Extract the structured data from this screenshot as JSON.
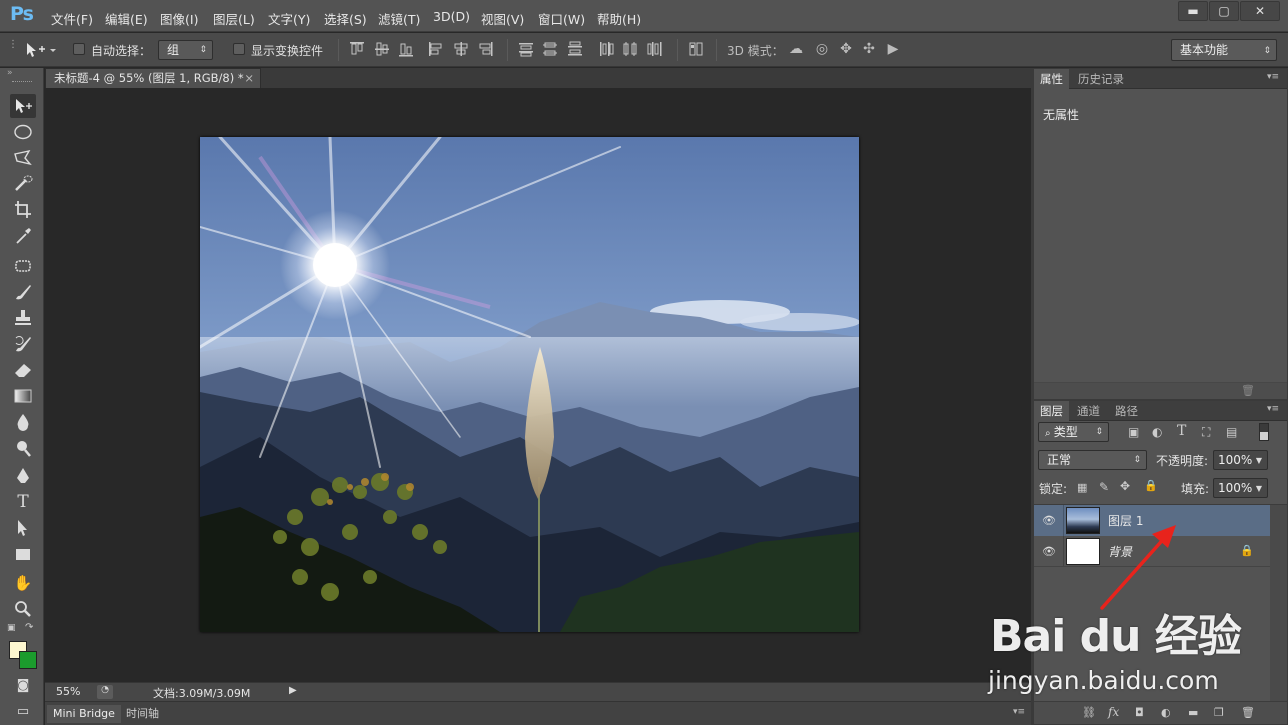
{
  "app": {
    "logo": "Ps"
  },
  "menu": [
    "文件(F)",
    "编辑(E)",
    "图像(I)",
    "图层(L)",
    "文字(Y)",
    "选择(S)",
    "滤镜(T)",
    "3D(D)",
    "视图(V)",
    "窗口(W)",
    "帮助(H)"
  ],
  "window_controls": {
    "minimize": "▬",
    "maximize": "▢",
    "close": "✕"
  },
  "options": {
    "auto_select_label": "自动选择：",
    "auto_select_value": "组",
    "show_transform_label": "显示变换控件",
    "mode3d_label": "3D 模式：",
    "workspace": "基本功能"
  },
  "document": {
    "tab_title": "未标题-4 @ 55% (图层 1, RGB/8) *",
    "tab_close": "×"
  },
  "status": {
    "zoom": "55%",
    "doc_info": "文档:3.09M/3.09M"
  },
  "bottom_tabs": [
    "Mini Bridge",
    "时间轴"
  ],
  "properties_panel": {
    "tabs": [
      "属性",
      "历史记录"
    ],
    "content": "无属性"
  },
  "layers_panel": {
    "tabs": [
      "图层",
      "通道",
      "路径"
    ],
    "filter": "类型",
    "blend_mode": "正常",
    "opacity_label": "不透明度:",
    "opacity_value": "100%",
    "lock_label": "锁定:",
    "fill_label": "填充:",
    "fill_value": "100%",
    "layers": [
      {
        "name": "图层 1",
        "selected": true
      },
      {
        "name": "背景",
        "selected": false,
        "locked": true
      }
    ]
  },
  "watermark": {
    "brand": "Bai du 经验",
    "url": "jingyan.baidu.com"
  },
  "colors": {
    "foreground": "#fdf7cf",
    "background": "#1b9b2d",
    "arrow": "#e8231c",
    "selection": "#5a6d86"
  },
  "tools": [
    "move-tool-icon",
    "ellipse-marquee-icon",
    "polygon-lasso-icon",
    "quick-select-icon",
    "crop-icon",
    "eyedropper-icon",
    "spot-healing-icon",
    "brush-icon",
    "clone-stamp-icon",
    "history-brush-icon",
    "eraser-icon",
    "gradient-icon",
    "blur-icon",
    "dodge-icon",
    "pen-icon",
    "type-icon",
    "path-select-icon",
    "rectangle-icon",
    "hand-icon",
    "zoom-icon"
  ]
}
